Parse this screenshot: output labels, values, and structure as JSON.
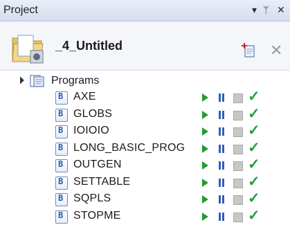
{
  "titlebar": {
    "title": "Project",
    "dropdown_icon": "▾",
    "pin_icon": "ᛘ",
    "close_icon": "✕"
  },
  "header": {
    "project_name": "_4_Untitled"
  },
  "tree": {
    "root_label": "Programs",
    "items": [
      {
        "label": "AXE"
      },
      {
        "label": "GLOBS"
      },
      {
        "label": "IOIOIO"
      },
      {
        "label": "LONG_BASIC_PROG"
      },
      {
        "label": "OUTGEN"
      },
      {
        "label": "SETTABLE"
      },
      {
        "label": "SQPLS"
      },
      {
        "label": "STOPME"
      }
    ],
    "file_badge": "B",
    "status_icon": "✓"
  },
  "colors": {
    "accent_play": "#1f9e2c",
    "accent_pause": "#2f5fb8",
    "check": "#22a02c"
  }
}
